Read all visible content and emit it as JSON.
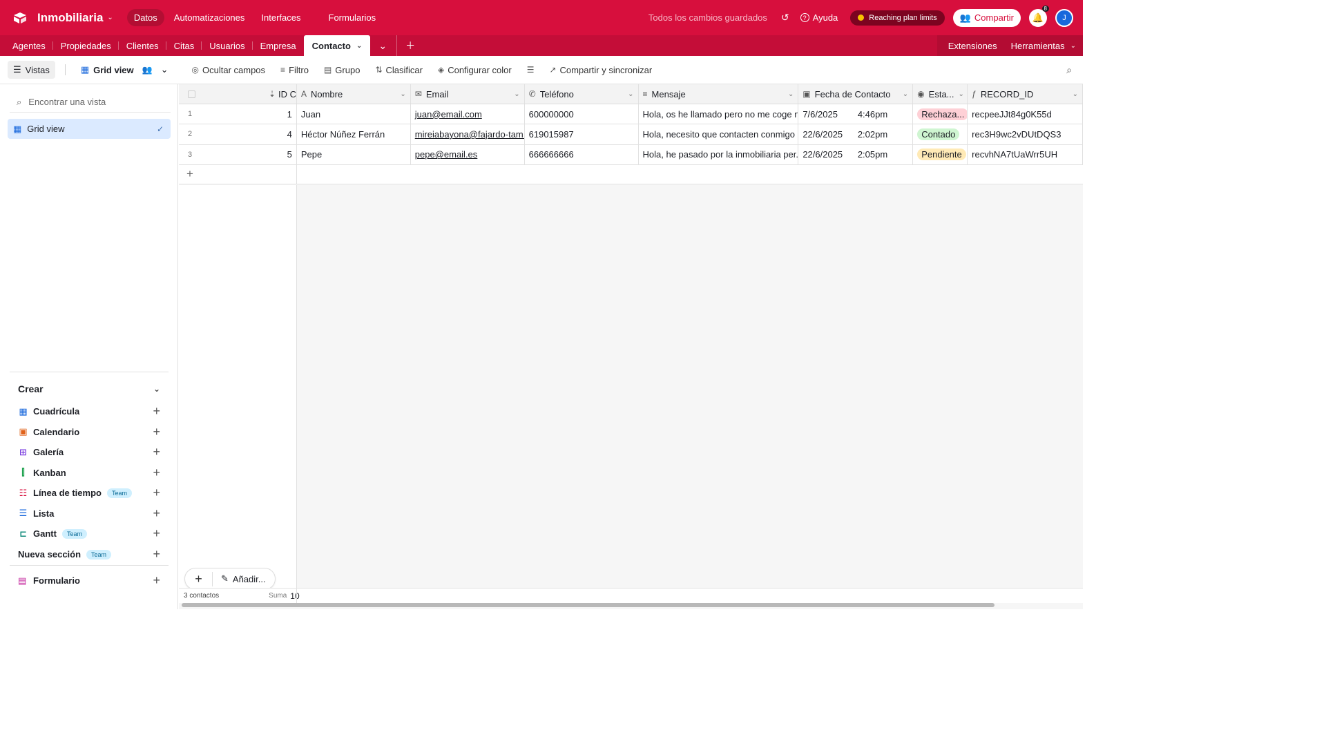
{
  "app": {
    "title": "Inmobiliaria"
  },
  "topnav": [
    "Datos",
    "Automatizaciones",
    "Interfaces",
    "Formularios"
  ],
  "status": {
    "saved": "Todos los cambios guardados",
    "help": "Ayuda",
    "plan": "Reaching plan limits",
    "share": "Compartir",
    "notifications": "8",
    "avatar_initial": "J"
  },
  "tabs": [
    "Agentes",
    "Propiedades",
    "Clientes",
    "Citas",
    "Usuarios",
    "Empresa",
    "Contacto"
  ],
  "tabs_right": [
    "Extensiones",
    "Herramientas"
  ],
  "toolbar": {
    "views": "Vistas",
    "grid_view": "Grid view",
    "hide": "Ocultar campos",
    "filter": "Filtro",
    "group": "Grupo",
    "sort": "Clasificar",
    "color": "Configurar color",
    "share_sync": "Compartir y sincronizar"
  },
  "sidebar": {
    "search_placeholder": "Encontrar una vista",
    "active_view": "Grid view",
    "create_title": "Crear",
    "create_items": [
      {
        "label": "Cuadrícula",
        "icon": "grid-icon",
        "color": "#1968dc"
      },
      {
        "label": "Calendario",
        "icon": "calendar-icon",
        "color": "#e0621a"
      },
      {
        "label": "Galería",
        "icon": "gallery-icon",
        "color": "#7b3fe0"
      },
      {
        "label": "Kanban",
        "icon": "kanban-icon",
        "color": "#19a04a"
      },
      {
        "label": "Línea de tiempo",
        "icon": "timeline-icon",
        "color": "#d70f3d",
        "badge": "Team"
      },
      {
        "label": "Lista",
        "icon": "list-icon",
        "color": "#1968dc"
      },
      {
        "label": "Gantt",
        "icon": "gantt-icon",
        "color": "#0f8a7a",
        "badge": "Team"
      }
    ],
    "section": {
      "label": "Nueva sección",
      "badge": "Team"
    },
    "form": "Formulario"
  },
  "grid": {
    "columns": [
      "ID Contacto",
      "Nombre",
      "Email",
      "Teléfono",
      "Mensaje",
      "Fecha de Contacto",
      "Esta...",
      "RECORD_ID"
    ],
    "rows": [
      {
        "n": "1",
        "id": "1",
        "nombre": "Juan",
        "email": "juan@email.com",
        "tel": "600000000",
        "msg": "Hola, os he llamado pero no me coge n...",
        "fecha": "7/6/2025",
        "hora": "4:46pm",
        "estado": "Rechaza...",
        "estado_color": "#fed0d6",
        "rec": "recpeeJJt84g0K55d"
      },
      {
        "n": "2",
        "id": "4",
        "nombre": "Héctor Núñez Ferrán",
        "email": "mireiabayona@fajardo-tam...",
        "tel": "619015987",
        "msg": "Hola, necesito que contacten conmigo ...",
        "fecha": "22/6/2025",
        "hora": "2:02pm",
        "estado": "Contado",
        "estado_color": "#cff5d1",
        "rec": "rec3H9wc2vDUtDQS3"
      },
      {
        "n": "3",
        "id": "5",
        "nombre": "Pepe",
        "email": "pepe@email.es",
        "tel": "666666666",
        "msg": "Hola, he pasado por la inmobiliaria per...",
        "fecha": "22/6/2025",
        "hora": "2:05pm",
        "estado": "Pendiente",
        "estado_color": "#ffeab6",
        "rec": "recvhNA7tUaWrr5UH"
      }
    ],
    "footer": {
      "count": "3 contactos",
      "sum_label": "Suma",
      "sum_value": "10"
    },
    "add_label": "Añadir..."
  },
  "colors": {
    "brand": "#d70f3d",
    "brand_dark": "#c40d38"
  }
}
